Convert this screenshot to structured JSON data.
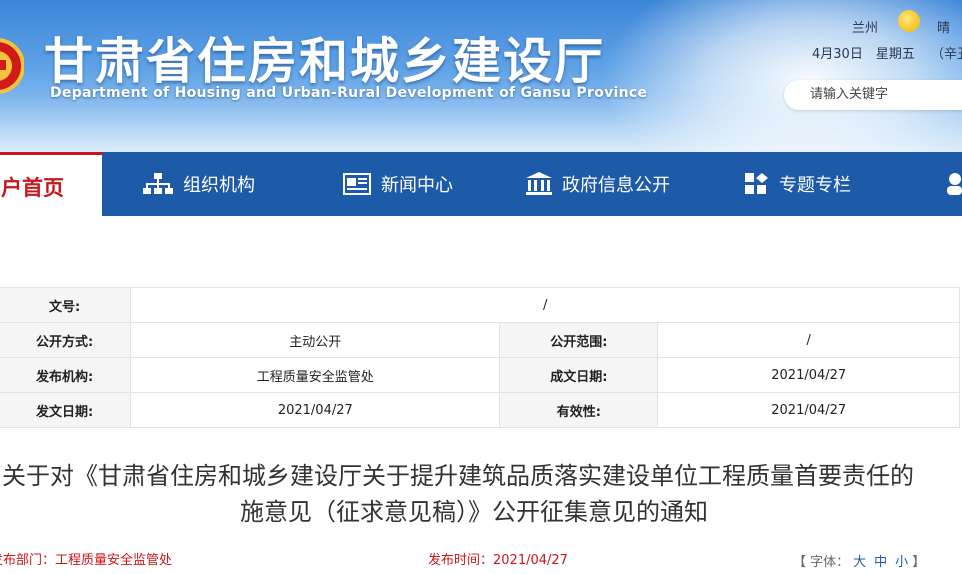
{
  "header": {
    "title": "甘肃省住房和城乡建设厅",
    "subtitle": "Department of Housing and Urban-Rural Development of Gansu Province",
    "weather": {
      "city": "兰州",
      "condition": "晴",
      "date": "4月30日　星期五",
      "lunar": "（辛丑"
    },
    "search_placeholder": "请输入关键字"
  },
  "nav": {
    "home": "户首页",
    "items": [
      {
        "label": "组织机构",
        "icon": "org-chart-icon"
      },
      {
        "label": "新闻中心",
        "icon": "newspaper-icon"
      },
      {
        "label": "政府信息公开",
        "icon": "government-building-icon"
      },
      {
        "label": "专题专栏",
        "icon": "tiles-icon"
      }
    ]
  },
  "meta": {
    "doc_no_label": "文号:",
    "doc_no_value": "/",
    "open_mode_label": "公开方式:",
    "open_mode_value": "主动公开",
    "open_scope_label": "公开范围:",
    "open_scope_value": "/",
    "publisher_label": "发布机构:",
    "publisher_value": "工程质量安全监管处",
    "created_label": "成文日期:",
    "created_value": "2021/04/27",
    "issued_label": "发文日期:",
    "issued_value": "2021/04/27",
    "validity_label": "有效性:",
    "validity_value": "2021/04/27"
  },
  "article": {
    "title_line1": "关于对《甘肃省住房和城乡建设厅关于提升建筑品质落实建设单位工程质量首要责任的",
    "title_line2": "施意见（征求意见稿）》公开征集意见的通知",
    "dept": "发布部门：工程质量安全监管处",
    "time": "发布时间：2021/04/27",
    "font_size": {
      "prefix": "【 字体：",
      "large": "大",
      "medium": "中",
      "small": "小",
      "suffix": "】"
    }
  },
  "colors": {
    "nav_blue": "#1d5aa8",
    "accent_red": "#c8161d"
  }
}
